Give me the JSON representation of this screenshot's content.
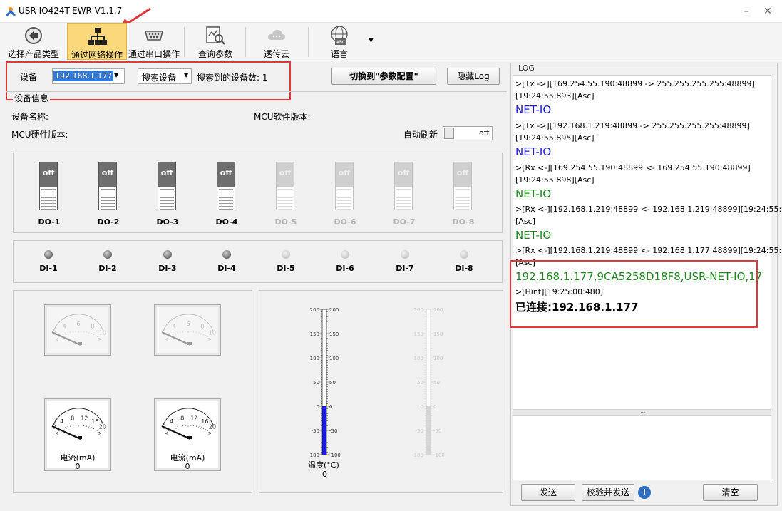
{
  "window": {
    "title": "USR-IO424T-EWR V1.1.7"
  },
  "toolbar": {
    "items": [
      {
        "label": "选择产品类型",
        "icon": "back-arrow-icon"
      },
      {
        "label": "通过网络操作",
        "icon": "network-icon"
      },
      {
        "label": "通过串口操作",
        "icon": "serial-port-icon"
      },
      {
        "label": "查询参数",
        "icon": "query-chart-icon"
      },
      {
        "label": "透传云",
        "icon": "cloud-icon"
      },
      {
        "label": "语言",
        "icon": "language-globe-icon"
      }
    ],
    "more_icon": "dropdown-arrow-icon"
  },
  "device_bar": {
    "device_label": "设备",
    "device_value": "192.168.1.177",
    "search_button": "搜索设备",
    "found_label": "搜索到的设备数:",
    "found_count": "1",
    "switch_button": "切换到\"参数配置\"",
    "hide_log_button": "隐藏Log"
  },
  "device_info": {
    "group_title": "设备信息",
    "name_label": "设备名称:",
    "mcu_sw_label": "MCU软件版本:",
    "mcu_hw_label": "MCU硬件版本:",
    "auto_refresh_label": "自动刷新",
    "auto_refresh_state": "off"
  },
  "do_switches": [
    {
      "label": "DO-1",
      "state": "off",
      "enabled": true
    },
    {
      "label": "DO-2",
      "state": "off",
      "enabled": true
    },
    {
      "label": "DO-3",
      "state": "off",
      "enabled": true
    },
    {
      "label": "DO-4",
      "state": "off",
      "enabled": true
    },
    {
      "label": "DO-5",
      "state": "off",
      "enabled": false
    },
    {
      "label": "DO-6",
      "state": "off",
      "enabled": false
    },
    {
      "label": "DO-7",
      "state": "off",
      "enabled": false
    },
    {
      "label": "DO-8",
      "state": "off",
      "enabled": false
    }
  ],
  "di_inputs": [
    {
      "label": "DI-1",
      "enabled": true
    },
    {
      "label": "DI-2",
      "enabled": true
    },
    {
      "label": "DI-3",
      "enabled": true
    },
    {
      "label": "DI-4",
      "enabled": true
    },
    {
      "label": "DI-5",
      "enabled": false
    },
    {
      "label": "DI-6",
      "enabled": false
    },
    {
      "label": "DI-7",
      "enabled": false
    },
    {
      "label": "DI-8",
      "enabled": false
    }
  ],
  "meters": {
    "dim_ticks": [
      "2",
      "4",
      "6",
      "8",
      "10"
    ],
    "active_ticks": [
      "0",
      "4",
      "8",
      "12",
      "16",
      "20"
    ],
    "active": [
      {
        "label": "电流(mA)",
        "value": "0"
      },
      {
        "label": "电流(mA)",
        "value": "0"
      }
    ]
  },
  "thermometer": {
    "ticks": [
      "200",
      "150",
      "100",
      "50",
      "0",
      "-50",
      "-100"
    ],
    "label": "温度(°C)",
    "value": "0",
    "reading": 0,
    "min": -100,
    "max": 200
  },
  "log": {
    "title": "LOG",
    "entries": [
      {
        "text": ">[Tx ->][169.254.55.190:48899 -> 255.255.255.255:48899]",
        "style": "small"
      },
      {
        "text": "[19:24:55:893][Asc]",
        "style": "small"
      },
      {
        "text": "NET-IO",
        "style": "blue"
      },
      {
        "text": ">[Tx ->][192.168.1.219:48899 -> 255.255.255.255:48899]",
        "style": "small"
      },
      {
        "text": "[19:24:55:895][Asc]",
        "style": "small"
      },
      {
        "text": "NET-IO",
        "style": "blue"
      },
      {
        "text": ">[Rx <-][169.254.55.190:48899 <- 169.254.55.190:48899]",
        "style": "small"
      },
      {
        "text": "[19:24:55:898][Asc]",
        "style": "small"
      },
      {
        "text": "NET-IO",
        "style": "green"
      },
      {
        "text": ">[Rx <-][192.168.1.219:48899 <- 192.168.1.219:48899][19:24:55:901]",
        "style": "small"
      },
      {
        "text": "[Asc]",
        "style": "small"
      },
      {
        "text": "NET-IO",
        "style": "green"
      },
      {
        "text": ">[Rx <-][192.168.1.219:48899 <- 192.168.1.177:48899][19:24:55:910]",
        "style": "small"
      },
      {
        "text": "[Asc]",
        "style": "small"
      },
      {
        "text": "192.168.1.177,9CA5258D18F8,USR-NET-IO,17",
        "style": "green"
      },
      {
        "text": ">[Hint][19:25:00:480]",
        "style": "small"
      },
      {
        "text": "已连接:192.168.1.177",
        "style": "bold"
      }
    ],
    "splitter": "....",
    "send_button": "发送",
    "verify_send_button": "校验并发送",
    "clear_button": "清空"
  },
  "colors": {
    "active_tab": "#fbd97b",
    "log_blue": "#1c1ccc",
    "log_green": "#1e8a1e",
    "highlight": "#e0393a",
    "thermo_fill": "#1a1ad6"
  }
}
